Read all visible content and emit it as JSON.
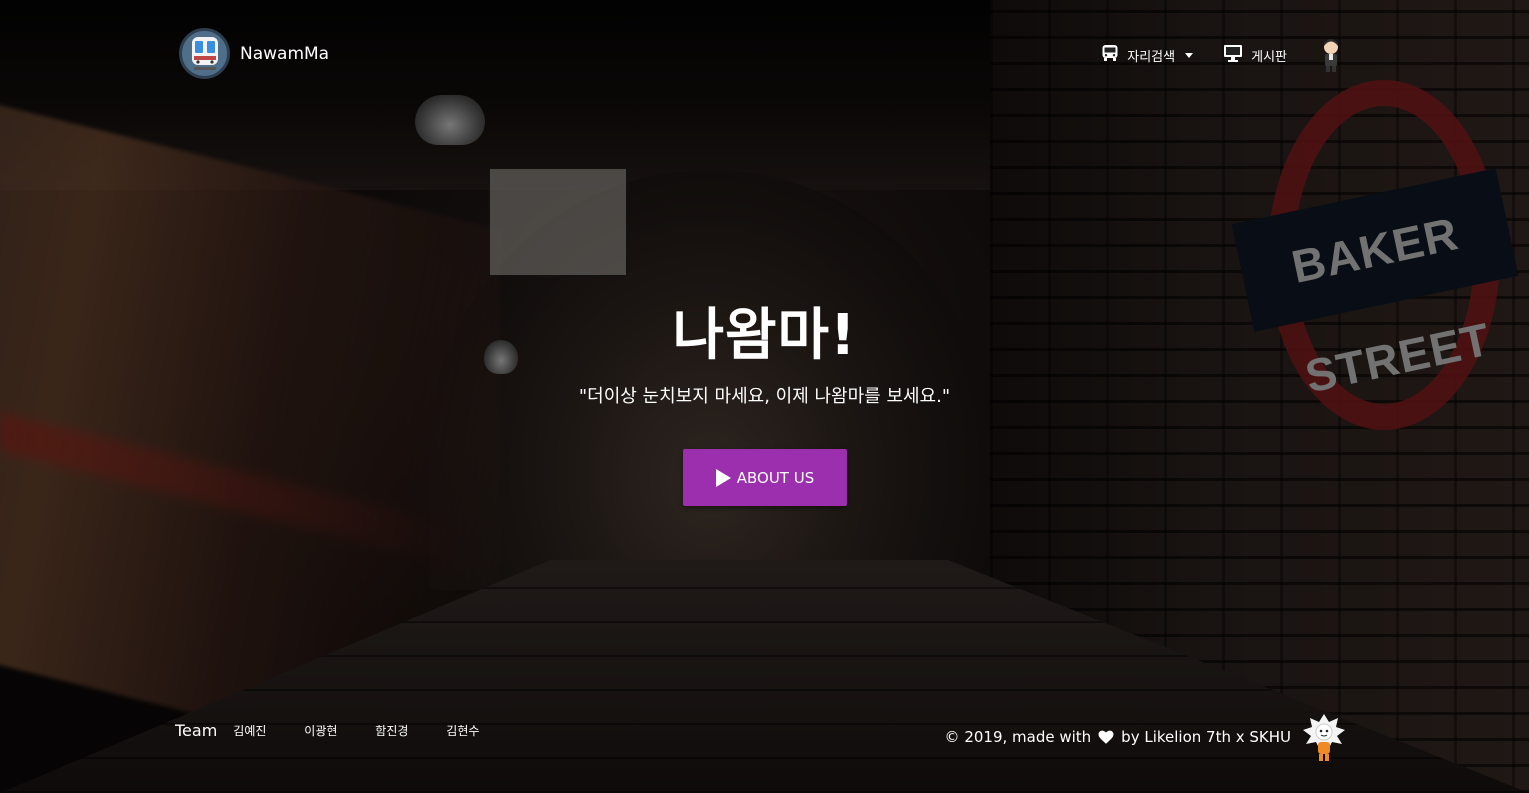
{
  "header": {
    "brand": {
      "name": "NawamMa",
      "logo_icon": "subway-train-icon"
    },
    "nav": [
      {
        "label": "자리검색",
        "icon": "bus-icon",
        "has_dropdown": true
      },
      {
        "label": "게시판",
        "icon": "monitor-icon",
        "has_dropdown": false
      }
    ],
    "avatar_icon": "user-avatar-icon"
  },
  "background": {
    "sign_text": "BAKER STREET"
  },
  "hero": {
    "title": "나왐마!",
    "subtitle": "\"더이상 눈치보지 마세요, 이제 나왐마를 보세요.\"",
    "cta_label": "ABOUT US",
    "cta_icon": "play-icon",
    "cta_color": "#9b2fae"
  },
  "footer": {
    "team_label": "Team",
    "members": [
      "김예진",
      "이광현",
      "함진경",
      "김현수"
    ],
    "credit_prefix": "© 2019, made with",
    "credit_suffix": "by Likelion 7th x SKHU",
    "heart_icon": "heart-icon",
    "mascot_icon": "likelion-mascot-icon"
  }
}
